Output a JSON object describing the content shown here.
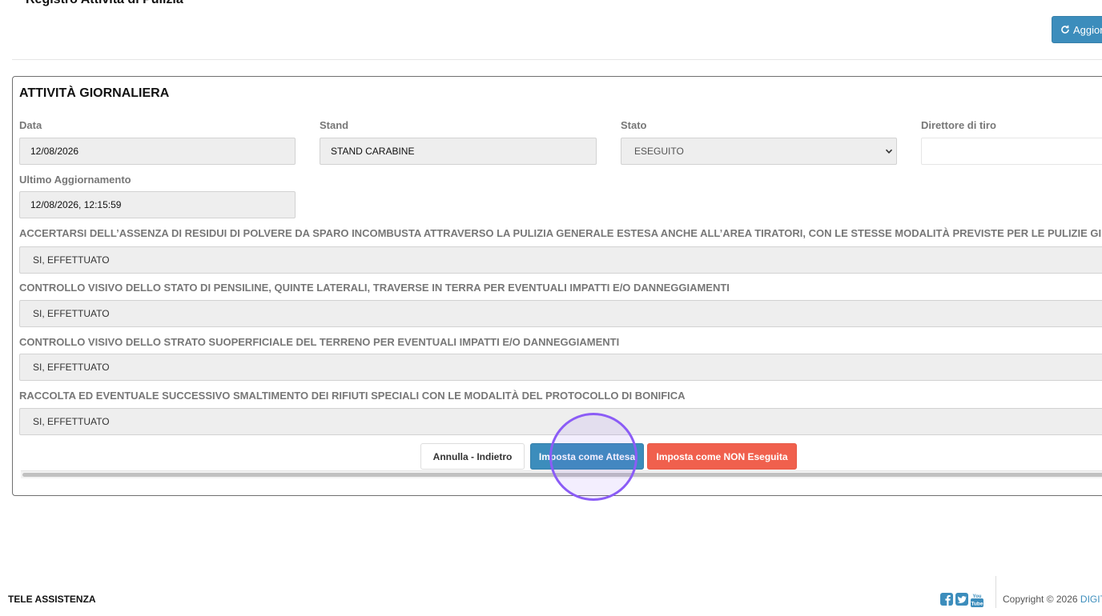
{
  "header": {
    "title": "Registro Attività di Pulizia",
    "refresh_label": "Aggiorna"
  },
  "card": {
    "title": "ATTIVITÀ GIORNALIERA",
    "fields": {
      "data": {
        "label": "Data",
        "value": "12/08/2026"
      },
      "stand": {
        "label": "Stand",
        "value": "STAND CARABINE"
      },
      "stato": {
        "label": "Stato",
        "value": "ESEGUITO"
      },
      "direttore": {
        "label": "Direttore di tiro",
        "value": ""
      },
      "ultimo": {
        "label": "Ultimo Aggiornamento",
        "value": "12/08/2026, 12:15:59"
      }
    },
    "checks": [
      {
        "label": "ACCERTARSI DELL’ASSENZA DI RESIDUI DI POLVERE DA SPARO INCOMBUSTA ATTRAVERSO LA PULIZIA GENERALE ESTESA ANCHE ALL’AREA TIRATORI, CON LE STESSE MODALITÀ PREVISTE PER LE PULIZIE GI",
        "value": "SI, EFFETTUATO"
      },
      {
        "label": "CONTROLLO VISIVO DELLO STATO DI PENSILINE, QUINTE LATERALI, TRAVERSE IN TERRA PER EVENTUALI IMPATTI E/O DANNEGGIAMENTI",
        "value": "SI, EFFETTUATO"
      },
      {
        "label": "CONTROLLO VISIVO DELLO STRATO SUOPERFICIALE DEL TERRENO PER EVENTUALI IMPATTI E/O DANNEGGIAMENTI",
        "value": "SI, EFFETTUATO"
      },
      {
        "label": "RACCOLTA ED EVENTUALE SUCCESSIVO SMALTIMENTO DEI RIFIUTI SPECIALI CON LE MODALITÀ DEL PROTOCOLLO DI BONIFICA",
        "value": "SI, EFFETTUATO"
      }
    ],
    "buttons": {
      "back": "Annulla - Indietro",
      "wait": "Imposta come Attesa",
      "not_done": "Imposta come NON Eseguita"
    }
  },
  "footer": {
    "left": "TELE ASSISTENZA",
    "copyright": "Copyright © 2026 ",
    "brand": "DIGIT",
    "icons": [
      "facebook-icon",
      "twitter-icon",
      "youtube-icon"
    ]
  },
  "colors": {
    "primary": "#3c8dbc",
    "danger": "#f0604d",
    "cursor": "#8b5cf6"
  }
}
